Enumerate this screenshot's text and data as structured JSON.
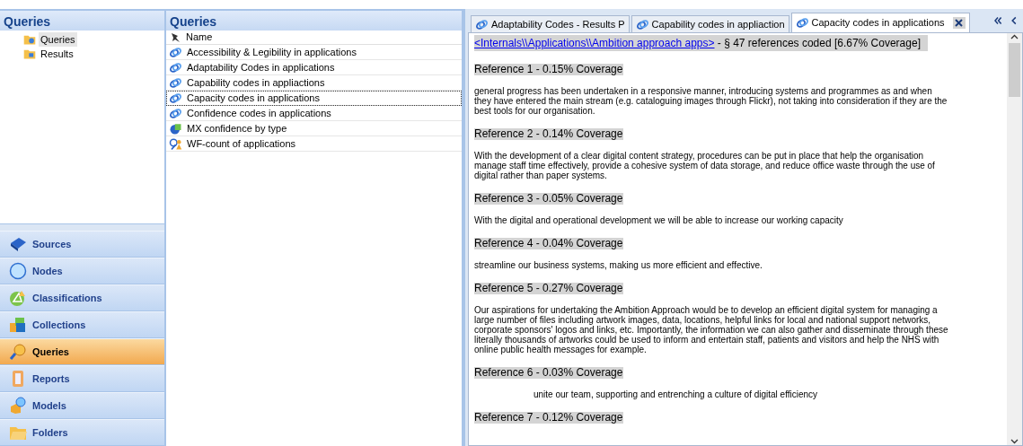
{
  "navigation_pane": {
    "title": "Queries",
    "tree": [
      {
        "label": "Queries",
        "kind": "queries",
        "selected": true
      },
      {
        "label": "Results",
        "kind": "results",
        "selected": false
      }
    ],
    "buttons": [
      {
        "label": "Sources",
        "kind": "sources",
        "selected": false
      },
      {
        "label": "Nodes",
        "kind": "nodes",
        "selected": false
      },
      {
        "label": "Classifications",
        "kind": "classifications",
        "selected": false
      },
      {
        "label": "Collections",
        "kind": "collections",
        "selected": false
      },
      {
        "label": "Queries",
        "kind": "queries",
        "selected": true
      },
      {
        "label": "Reports",
        "kind": "reports",
        "selected": false
      },
      {
        "label": "Models",
        "kind": "models",
        "selected": false
      },
      {
        "label": "Folders",
        "kind": "folders",
        "selected": false
      }
    ]
  },
  "list_view": {
    "title": "Queries",
    "column": "Name",
    "rows": [
      {
        "name": "Accessibility & Legibility in applications",
        "kind": "coding",
        "selected": false
      },
      {
        "name": "Adaptability Codes in applications",
        "kind": "coding",
        "selected": false
      },
      {
        "name": "Capability codes in appliactions",
        "kind": "coding",
        "selected": false
      },
      {
        "name": "Capacity codes in applications",
        "kind": "coding",
        "selected": true
      },
      {
        "name": "Confidence codes in applications",
        "kind": "coding",
        "selected": false
      },
      {
        "name": "MX confidence by type",
        "kind": "matrix",
        "selected": false
      },
      {
        "name": "WF-count of applications",
        "kind": "count",
        "selected": false
      }
    ]
  },
  "detail_view": {
    "tabs": [
      {
        "label": "Adaptability Codes - Results P",
        "selected": false
      },
      {
        "label": "Capability codes in appliaction",
        "selected": false
      },
      {
        "label": "Capacity codes in applications",
        "selected": true
      }
    ],
    "source_link": "<Internals\\\\Applications\\\\Ambition approach apps>",
    "summary": " - § 47 references coded  [6.67% Coverage]",
    "content": [
      {
        "kind": "heading",
        "text": "Reference 1 - 0.15% Coverage"
      },
      {
        "kind": "passage",
        "text": " general progress has been undertaken in a responsive manner, introducing systems and programmes as and when they have entered the main stream  (e.g. cataloguing images through Flickr), not taking into consideration if they are the best tools for our organisation."
      },
      {
        "kind": "heading",
        "text": "Reference 2 - 0.14% Coverage"
      },
      {
        "kind": "passage",
        "text": "With the development of a clear digital content strategy, procedures can be put in place that help the organisation manage staff time effectively, provide a cohesive system  of data storage, and reduce office waste through the use of digital rather than paper systems."
      },
      {
        "kind": "heading",
        "text": "Reference 3 - 0.05% Coverage"
      },
      {
        "kind": "passage",
        "text": "With the digital and operational development we will be able to increase our working capacity"
      },
      {
        "kind": "heading",
        "text": "Reference 4 - 0.04% Coverage"
      },
      {
        "kind": "passage",
        "text": "streamline our business systems, making us more efficient and effective."
      },
      {
        "kind": "heading",
        "text": "Reference 5 - 0.27% Coverage"
      },
      {
        "kind": "passage",
        "text": "Our aspirations for undertaking the Ambition Approach would be to develop an efficient digital system for managing a large number of files including artwork images, data, locations, helpful links for local and national support networks, corporate sponsors' logos and links, etc. Importantly, the information we can also gather and disseminate through these literally thousands of artworks could be used to inform  and entertain staff, patients and visitors and help the NHS with online public health messages for example."
      },
      {
        "kind": "heading",
        "text": "Reference 6 - 0.03% Coverage"
      },
      {
        "kind": "indented-passage",
        "text": "unite our team, supporting and entrenching a culture of digital efficiency"
      },
      {
        "kind": "heading",
        "text": "Reference 7 - 0.12% Coverage"
      }
    ]
  }
}
